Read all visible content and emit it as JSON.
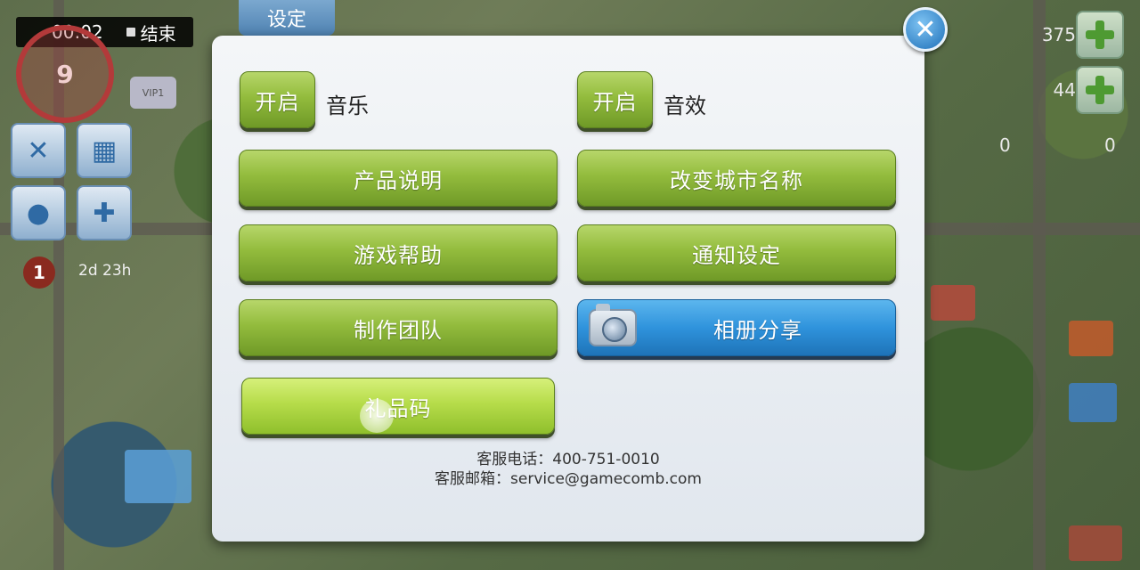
{
  "recording": {
    "time": "00:02",
    "stop_label": "结束"
  },
  "hud": {
    "level": "9",
    "vip": "VIP1",
    "event_badge": "1",
    "event_timer": "2d 23h",
    "right": {
      "coins": "375",
      "cash": "44",
      "keys_a": "0",
      "keys_b": "0"
    }
  },
  "settings_tab": {
    "title": "设定"
  },
  "dialog": {
    "music": {
      "toggle_label": "开启",
      "label": "音乐"
    },
    "sfx": {
      "toggle_label": "开启",
      "label": "音效"
    },
    "buttons": {
      "product_info": "产品说明",
      "rename_city": "改变城市名称",
      "game_help": "游戏帮助",
      "notification_settings": "通知设定",
      "credits": "制作团队",
      "album_share": "相册分享",
      "gift_code": "礼品码"
    },
    "contact": {
      "phone": "客服电话：400-751-0010",
      "email": "客服邮箱：service@gamecomb.com"
    }
  },
  "colors": {
    "green_button": "#93bc3d",
    "blue_button": "#2f93dc",
    "dialog_bg": "#eef2f6",
    "close_button": "#1d6fb8"
  }
}
